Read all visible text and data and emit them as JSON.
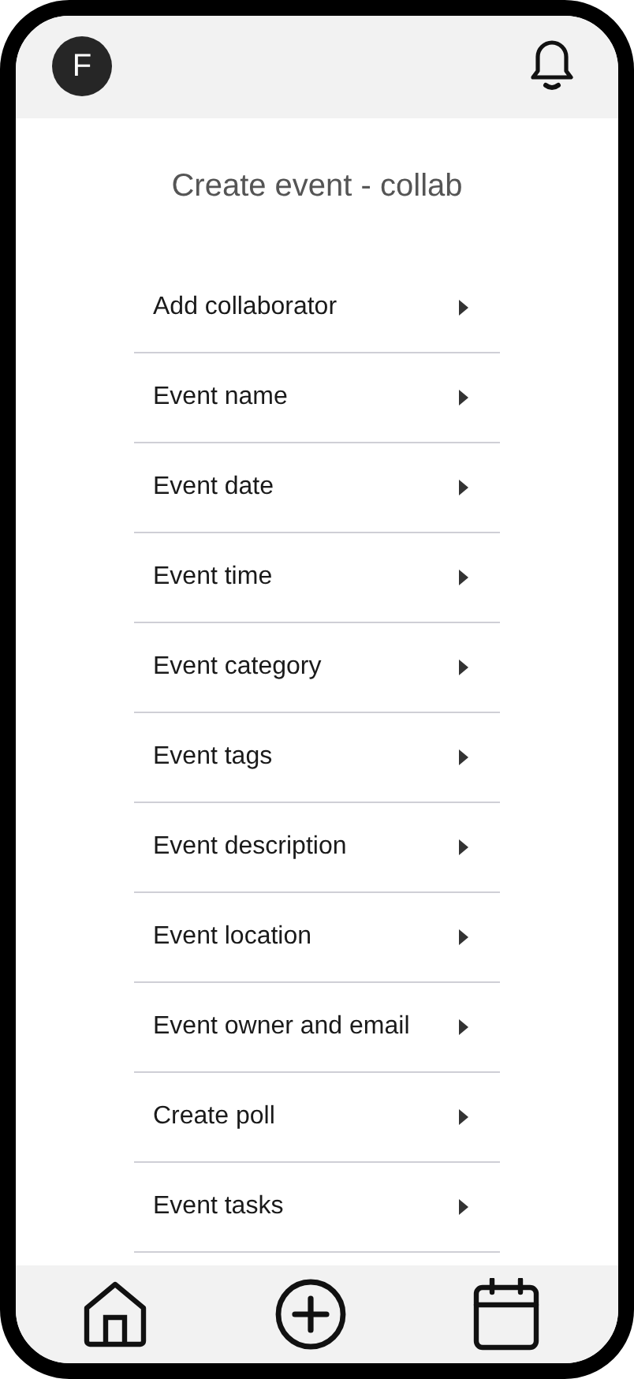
{
  "header": {
    "avatar_initial": "F"
  },
  "title": "Create event - collab",
  "items": [
    {
      "label": "Add collaborator"
    },
    {
      "label": "Event name"
    },
    {
      "label": "Event date"
    },
    {
      "label": "Event time"
    },
    {
      "label": "Event category"
    },
    {
      "label": "Event tags"
    },
    {
      "label": "Event description"
    },
    {
      "label": "Event location"
    },
    {
      "label": "Event owner and email"
    },
    {
      "label": "Create poll"
    },
    {
      "label": "Event tasks"
    }
  ],
  "nav": [
    {
      "kind": "home"
    },
    {
      "kind": "add"
    },
    {
      "kind": "calendar"
    }
  ]
}
